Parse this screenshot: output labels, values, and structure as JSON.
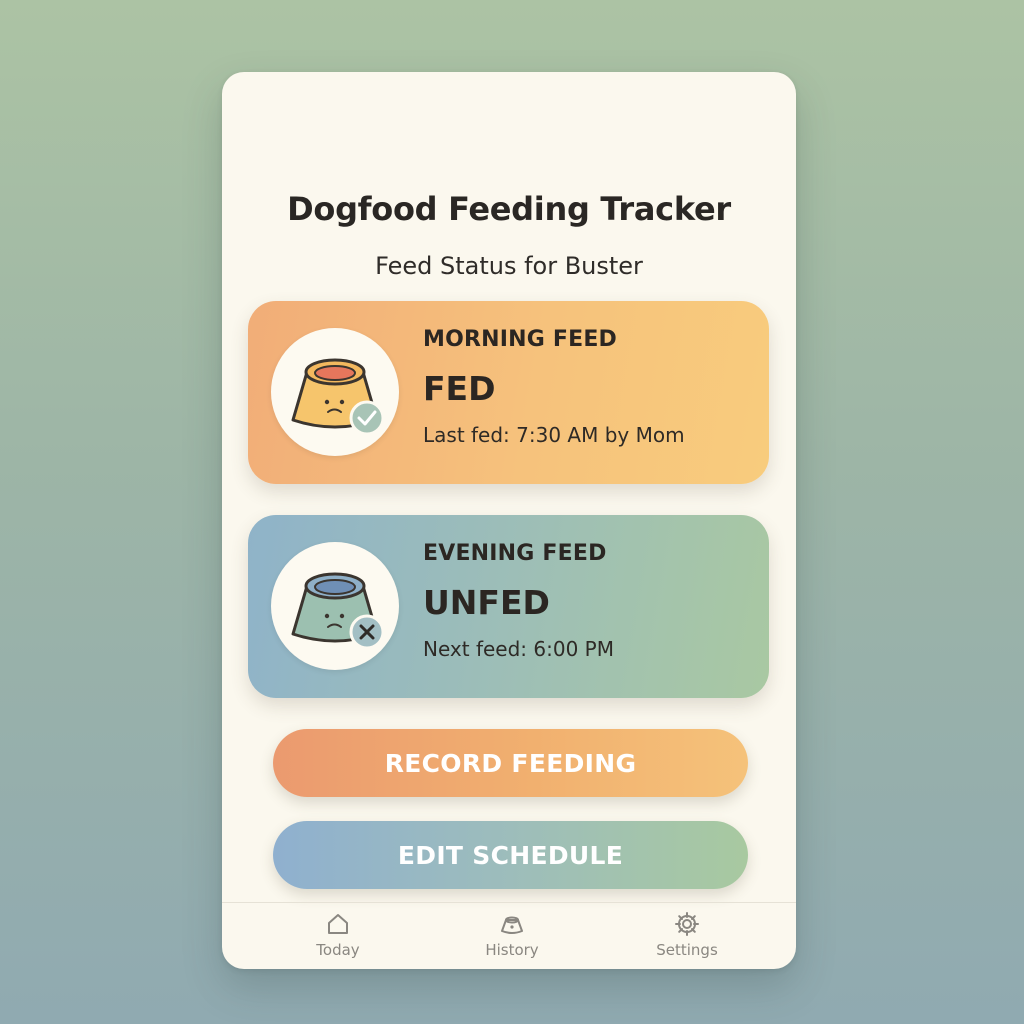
{
  "app": {
    "title": "Dogfood Feeding Tracker",
    "subtitle": "Feed Status for Buster"
  },
  "feeds": [
    {
      "label": "MORNING FEED",
      "status": "FED",
      "detail": "Last fed: 7:30 AM by Mom",
      "icon": "bowl-check-icon",
      "badge": "check-icon",
      "colors": {
        "start": "#f1ad78",
        "end": "#f8cc7d"
      }
    },
    {
      "label": "EVENING FEED",
      "status": "UNFED",
      "detail": "Next feed: 6:00 PM",
      "icon": "bowl-x-icon",
      "badge": "x-icon",
      "colors": {
        "start": "#8fb3c9",
        "end": "#a9c8a2"
      }
    }
  ],
  "actions": {
    "record_label": "RECORD FEEDING",
    "edit_label": "EDIT SCHEDULE"
  },
  "tabs": [
    {
      "label": "Today",
      "icon": "home-icon"
    },
    {
      "label": "History",
      "icon": "bowl-icon"
    },
    {
      "label": "Settings",
      "icon": "gear-icon"
    }
  ],
  "colors": {
    "background": "#a4bcab",
    "panel": "#fbf8ee",
    "text": "#2b2622",
    "tab_text": "#8a8781"
  }
}
